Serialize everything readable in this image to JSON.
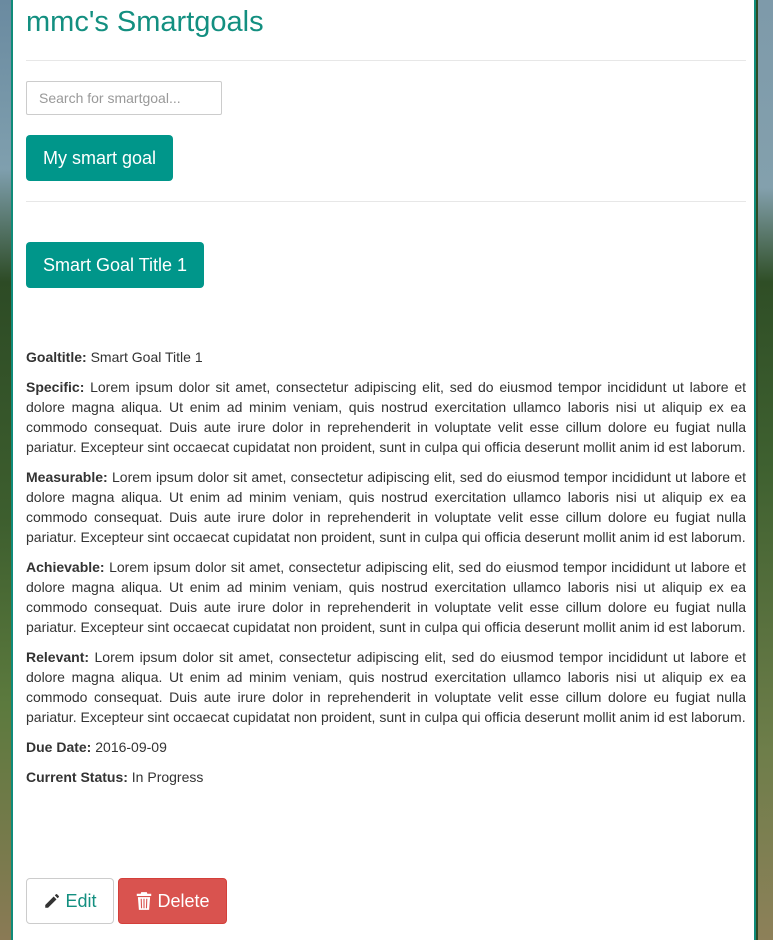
{
  "header": {
    "title": "mmc's Smartgoals"
  },
  "search": {
    "placeholder": "Search for smartgoal..."
  },
  "buttons": {
    "my_goal": "My smart goal",
    "goal_title": "Smart Goal Title 1",
    "edit": "Edit",
    "delete": "Delete"
  },
  "goal": {
    "goaltitle_label": "Goaltitle:",
    "goaltitle_value": "Smart Goal Title 1",
    "specific_label": "Specific:",
    "specific_value": "Lorem ipsum dolor sit amet, consectetur adipiscing elit, sed do eiusmod tempor incididunt ut labore et dolore magna aliqua. Ut enim ad minim veniam, quis nostrud exercitation ullamco laboris nisi ut aliquip ex ea commodo consequat. Duis aute irure dolor in reprehenderit in voluptate velit esse cillum dolore eu fugiat nulla pariatur. Excepteur sint occaecat cupidatat non proident, sunt in culpa qui officia deserunt mollit anim id est laborum.",
    "measurable_label": "Measurable:",
    "measurable_value": "Lorem ipsum dolor sit amet, consectetur adipiscing elit, sed do eiusmod tempor incididunt ut labore et dolore magna aliqua. Ut enim ad minim veniam, quis nostrud exercitation ullamco laboris nisi ut aliquip ex ea commodo consequat. Duis aute irure dolor in reprehenderit in voluptate velit esse cillum dolore eu fugiat nulla pariatur. Excepteur sint occaecat cupidatat non proident, sunt in culpa qui officia deserunt mollit anim id est laborum.",
    "achievable_label": "Achievable:",
    "achievable_value": "Lorem ipsum dolor sit amet, consectetur adipiscing elit, sed do eiusmod tempor incididunt ut labore et dolore magna aliqua. Ut enim ad minim veniam, quis nostrud exercitation ullamco laboris nisi ut aliquip ex ea commodo consequat. Duis aute irure dolor in reprehenderit in voluptate velit esse cillum dolore eu fugiat nulla pariatur. Excepteur sint occaecat cupidatat non proident, sunt in culpa qui officia deserunt mollit anim id est laborum.",
    "relevant_label": "Relevant:",
    "relevant_value": "Lorem ipsum dolor sit amet, consectetur adipiscing elit, sed do eiusmod tempor incididunt ut labore et dolore magna aliqua. Ut enim ad minim veniam, quis nostrud exercitation ullamco laboris nisi ut aliquip ex ea commodo consequat. Duis aute irure dolor in reprehenderit in voluptate velit esse cillum dolore eu fugiat nulla pariatur. Excepteur sint occaecat cupidatat non proident, sunt in culpa qui officia deserunt mollit anim id est laborum.",
    "due_label": "Due Date:",
    "due_value": "2016-09-09",
    "status_label": "Current Status:",
    "status_value": "In Progress"
  },
  "icons": {
    "edit": "pencil-icon",
    "delete": "trash-icon"
  },
  "colors": {
    "accent": "#00968a",
    "title": "#138f80",
    "danger": "#d9534f"
  }
}
